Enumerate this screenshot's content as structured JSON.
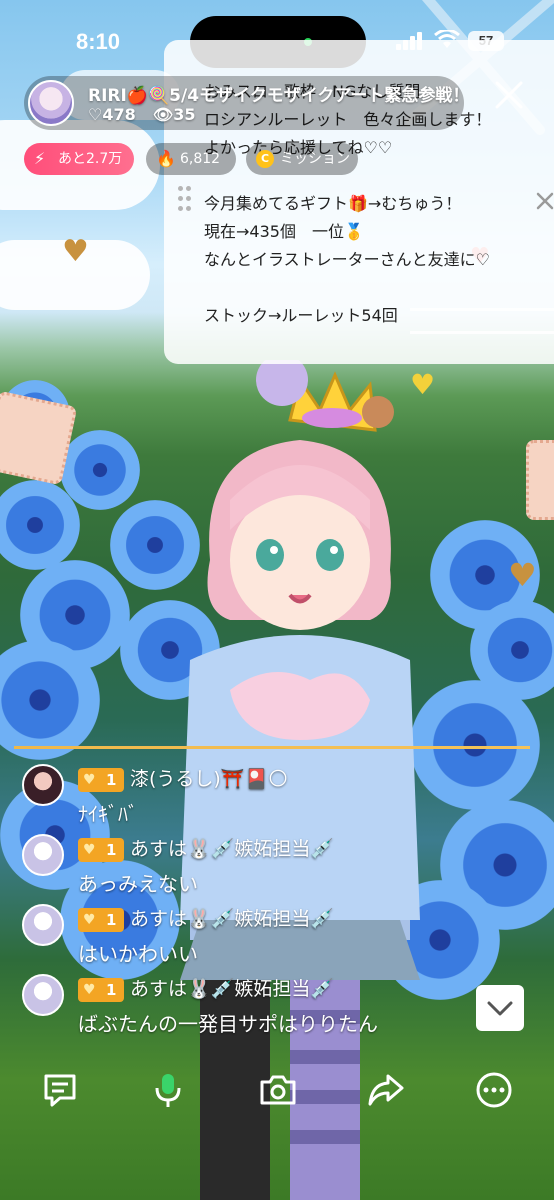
{
  "status_bar": {
    "time": "8:10",
    "battery": "57"
  },
  "streamer": {
    "name": "RIRI🍎🍭5/4モザイクモザイクアート緊急参戦！",
    "likes": "♡478",
    "viewers": "👁35"
  },
  "badges": {
    "fire": "あと2.7万",
    "heat": "6,812",
    "mission_icon": "C",
    "mission": "ミッション"
  },
  "notice": {
    "lines": [
      "おみスロ　歌枠　NGなし質問",
      "ロシアンルーレット　色々企画します！",
      "よかったら応援してね♡♡",
      "",
      "今月集めてるギフト🎁→むちゅう！",
      "現在→435個　一位🥇",
      "なんとイラストレーターさんと友達に♡",
      "",
      "ストック→ルーレット54回"
    ]
  },
  "chat": [
    {
      "level": "1",
      "name": "漆(うるし)⛩️🎴🌕",
      "message": "ﾅｲｷﾞﾊﾞ"
    },
    {
      "level": "1",
      "name": "あすは🐰💉嫉妬担当💉",
      "message": "あっみえない"
    },
    {
      "level": "1",
      "name": "あすは🐰💉嫉妬担当💉",
      "message": "はいかわいい"
    },
    {
      "level": "1",
      "name": "あすは🐰💉嫉妬担当💉",
      "message": "ばぶたんの一発目サポはりりたん"
    }
  ],
  "icons": [
    "chat-icon",
    "mic-icon",
    "camera-icon",
    "share-icon",
    "more-icon",
    "chevron-down-icon",
    "close-icon"
  ],
  "colors": {
    "accent_pink": "#ff4e7a",
    "level_badge": "#f3a524",
    "divider": "#f0b84a"
  }
}
